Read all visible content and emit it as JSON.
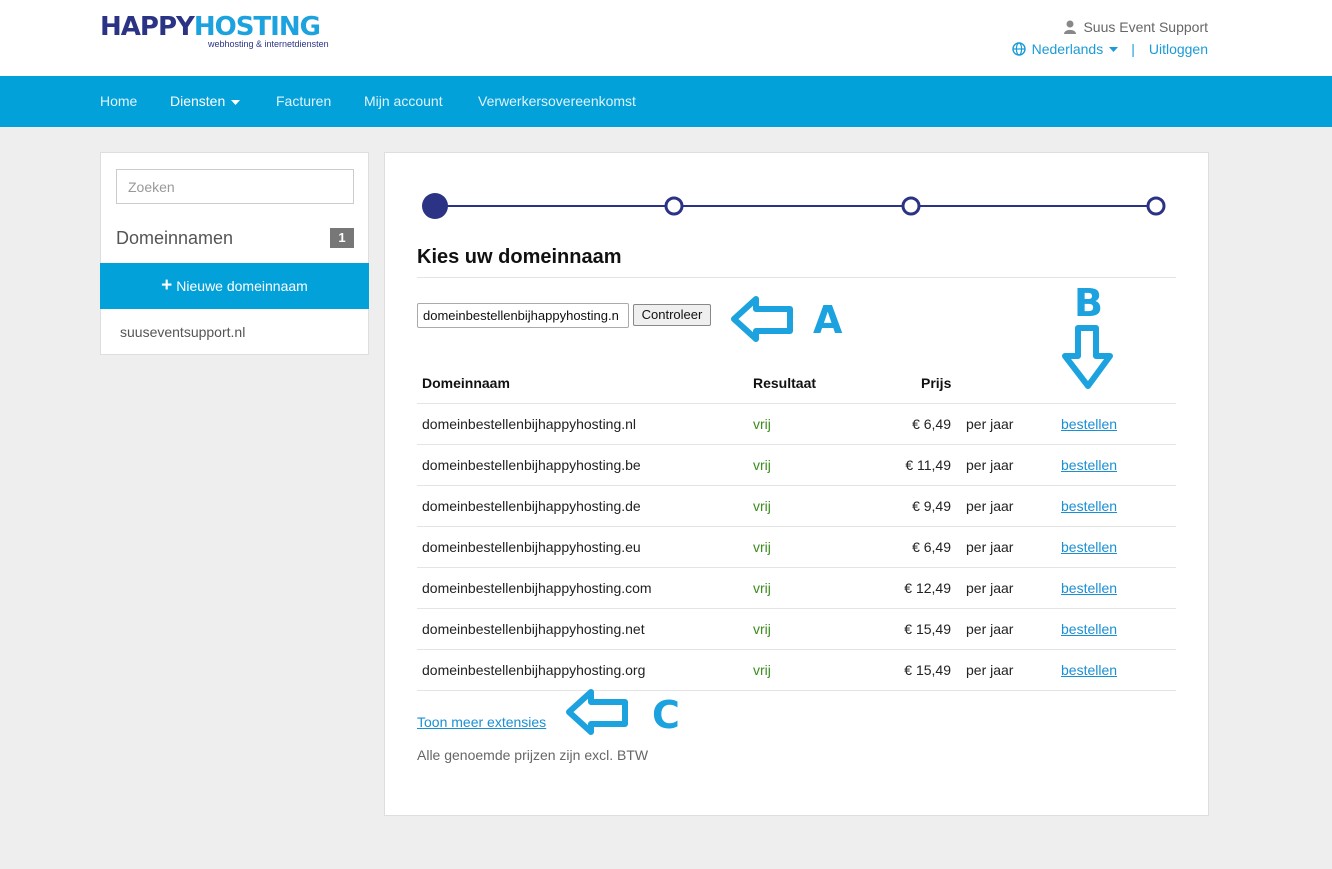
{
  "brand": {
    "name_part1": "HAPPY",
    "name_part2": "HOSTING",
    "tagline": "webhosting & internetdiensten",
    "primary_color": "#2b3384",
    "accent_color": "#02a1da"
  },
  "header": {
    "user": "Suus Event Support",
    "language": "Nederlands",
    "separator": "|",
    "logout": "Uitloggen"
  },
  "nav": {
    "items": [
      "Home",
      "Diensten",
      "Facturen",
      "Mijn account",
      "Verwerkersovereenkomst"
    ],
    "active": "Diensten"
  },
  "sidebar": {
    "search_placeholder": "Zoeken",
    "section_title": "Domeinnamen",
    "section_count": "1",
    "new_button": "Nieuwe domeinnaam",
    "domains": [
      "suuseventsupport.nl"
    ]
  },
  "main": {
    "steps_total": 4,
    "current_step": 1,
    "title": "Kies uw domeinnaam",
    "domain_input_value": "domeinbestellenbijhappyhosting.n",
    "check_button": "Controleer",
    "columns": {
      "domain": "Domeinnaam",
      "result": "Resultaat",
      "price": "Prijs"
    },
    "rows": [
      {
        "domain": "domeinbestellenbijhappyhosting.nl",
        "result": "vrij",
        "price": "€ 6,49",
        "period": "per jaar",
        "action": "bestellen"
      },
      {
        "domain": "domeinbestellenbijhappyhosting.be",
        "result": "vrij",
        "price": "€ 11,49",
        "period": "per jaar",
        "action": "bestellen"
      },
      {
        "domain": "domeinbestellenbijhappyhosting.de",
        "result": "vrij",
        "price": "€ 9,49",
        "period": "per jaar",
        "action": "bestellen"
      },
      {
        "domain": "domeinbestellenbijhappyhosting.eu",
        "result": "vrij",
        "price": "€ 6,49",
        "period": "per jaar",
        "action": "bestellen"
      },
      {
        "domain": "domeinbestellenbijhappyhosting.com",
        "result": "vrij",
        "price": "€ 12,49",
        "period": "per jaar",
        "action": "bestellen"
      },
      {
        "domain": "domeinbestellenbijhappyhosting.net",
        "result": "vrij",
        "price": "€ 15,49",
        "period": "per jaar",
        "action": "bestellen"
      },
      {
        "domain": "domeinbestellenbijhappyhosting.org",
        "result": "vrij",
        "price": "€ 15,49",
        "period": "per jaar",
        "action": "bestellen"
      }
    ],
    "more_link": "Toon meer extensies",
    "note": "Alle genoemde prijzen zijn excl. BTW"
  },
  "annotations": {
    "a": "A",
    "b": "B",
    "c": "C"
  }
}
